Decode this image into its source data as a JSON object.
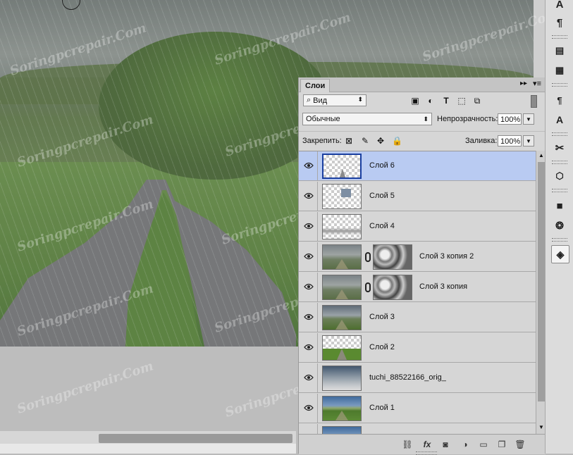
{
  "panel": {
    "tab_label": "Слои",
    "collapse_glyph": "▸▸",
    "menu_glyph": "▾≡",
    "filter": {
      "kind_label": "Вид",
      "chevron": "⬍"
    },
    "blend_mode": "Обычные",
    "opacity_label": "Непрозрачность:",
    "opacity_value": "100%",
    "lock_label": "Закрепить:",
    "fill_label": "Заливка:",
    "fill_value": "100%"
  },
  "layers": [
    {
      "name": "Слой 6",
      "selected": true,
      "visible": true,
      "thumb": "transparent-arrow",
      "mask": false
    },
    {
      "name": "Слой 5",
      "selected": false,
      "visible": true,
      "thumb": "transparent-small",
      "mask": false
    },
    {
      "name": "Слой 4",
      "selected": false,
      "visible": true,
      "thumb": "transparent-gradient",
      "mask": false
    },
    {
      "name": "Слой 3 копия 2",
      "selected": false,
      "visible": true,
      "thumb": "rain",
      "mask": true
    },
    {
      "name": "Слой 3 копия",
      "selected": false,
      "visible": true,
      "thumb": "rain",
      "mask": true
    },
    {
      "name": "Слой 3",
      "selected": false,
      "visible": true,
      "thumb": "stormy",
      "mask": false
    },
    {
      "name": "Слой 2",
      "selected": false,
      "visible": true,
      "thumb": "transparent-road",
      "mask": false
    },
    {
      "name": "tuchi_88522166_orig_",
      "selected": false,
      "visible": true,
      "thumb": "clouds",
      "mask": false
    },
    {
      "name": "Слой 1",
      "selected": false,
      "visible": true,
      "thumb": "photo",
      "mask": false
    },
    {
      "name": "",
      "selected": false,
      "visible": false,
      "thumb": "photo",
      "mask": false
    }
  ],
  "footer": {
    "icons": [
      "link-icon",
      "fx-icon",
      "mask-icon",
      "adjustment-icon",
      "folder-icon",
      "new-layer-icon",
      "trash-icon"
    ],
    "fx_label": "fx"
  },
  "toolstrip": {
    "icons": [
      "character-icon",
      "paragraph-icon",
      "notes-icon",
      "paragraph-styles-icon",
      "character-styles-icon",
      "tool-presets-icon",
      "3d-icon",
      "3d-cube-icon",
      "channels-icon",
      "layers-icon"
    ],
    "glyphs": {
      "character": "A",
      "paragraph": "¶"
    }
  },
  "watermark": "Soringpcrepair.Com",
  "colors": {
    "selection": "#b9cbf2",
    "panel_bg": "#d6d6d6"
  }
}
